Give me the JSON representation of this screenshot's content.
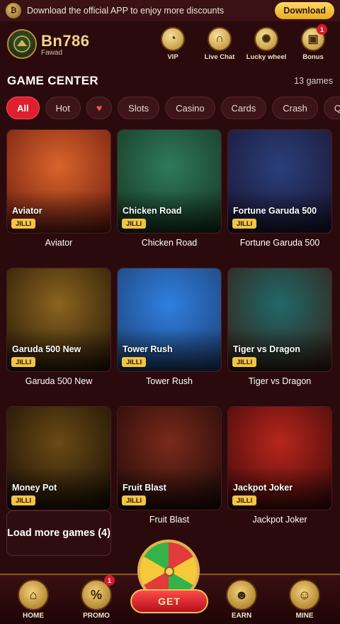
{
  "banner": {
    "message": "Download the official APP to enjoy more discounts",
    "download_label": "Download"
  },
  "header": {
    "brand": "Bn786",
    "username": "Fawad",
    "nav": [
      {
        "label": "VIP",
        "icon": "crown-icon",
        "glyph": "◔"
      },
      {
        "label": "Live Chat",
        "icon": "headset-icon",
        "glyph": "∩"
      },
      {
        "label": "Lucky wheel",
        "icon": "wheel-icon",
        "glyph": "✺"
      },
      {
        "label": "Bonus",
        "icon": "gift-icon",
        "glyph": "▣",
        "badge": "1"
      }
    ]
  },
  "game_center": {
    "title": "GAME CENTER",
    "count": "13 games",
    "filters": [
      "All",
      "Hot",
      "♥",
      "Slots",
      "Casino",
      "Cards",
      "Crash",
      "Quic"
    ],
    "active_filter": "All",
    "games": [
      {
        "name": "Aviator",
        "provider": "JILLI",
        "bg": [
          "#d9642a",
          "#6b1a10"
        ]
      },
      {
        "name": "Chicken Road",
        "provider": "JILLI",
        "bg": [
          "#2f7a5c",
          "#14331f"
        ]
      },
      {
        "name": "Fortune Garuda 500",
        "provider": "JILLI",
        "bg": [
          "#2a3f7a",
          "#1a1430"
        ]
      },
      {
        "name": "Garuda 500 New",
        "provider": "JILLI",
        "bg": [
          "#8a6420",
          "#241505"
        ]
      },
      {
        "name": "Tower Rush",
        "provider": "JILLI",
        "bg": [
          "#2f7fe0",
          "#1d3d6e"
        ]
      },
      {
        "name": "Tiger vs Dragon",
        "provider": "JILLI",
        "bg": [
          "#1f6a6a",
          "#3a1a10"
        ]
      },
      {
        "name": "Money Pot",
        "provider": "JILLI",
        "bg": [
          "#6a4a14",
          "#150c04"
        ]
      },
      {
        "name": "Fruit Blast",
        "provider": "JILLI",
        "bg": [
          "#7a2a1a",
          "#1c0808"
        ]
      },
      {
        "name": "Jackpot Joker",
        "provider": "JILLI",
        "bg": [
          "#b8261c",
          "#3a0808"
        ]
      }
    ],
    "load_more": "Load more games (4)"
  },
  "bottom_nav": {
    "items": [
      {
        "label": "HOME",
        "icon": "home-icon",
        "glyph": "⌂"
      },
      {
        "label": "PROMO",
        "icon": "percent-icon",
        "glyph": "%",
        "badge": "1"
      },
      {
        "label": "EARN",
        "icon": "people-icon",
        "glyph": "☻"
      },
      {
        "label": "MINE",
        "icon": "user-icon",
        "glyph": "☺"
      }
    ],
    "get_label": "GET"
  }
}
